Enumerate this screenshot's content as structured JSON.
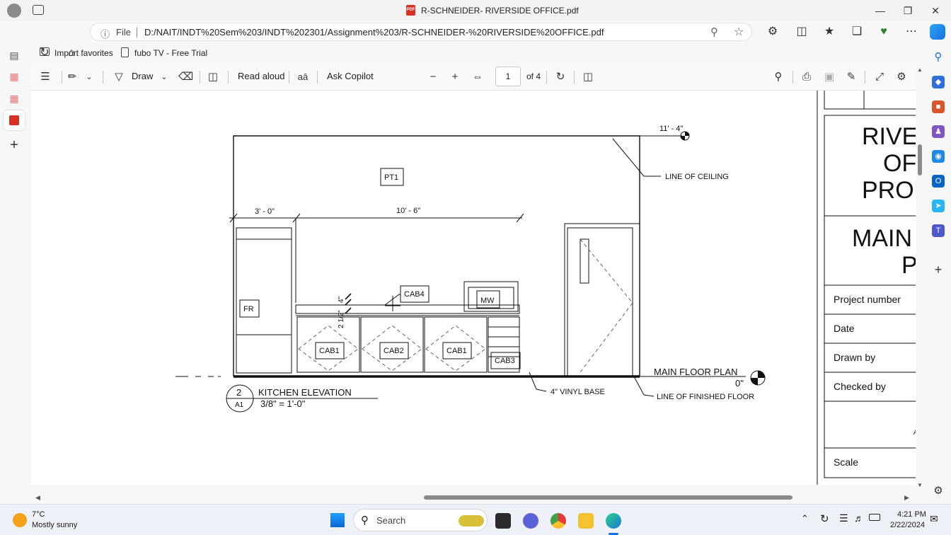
{
  "window": {
    "title": "R-SCHNEIDER- RIVERSIDE OFFICE.pdf",
    "pdf_badge": "PDF"
  },
  "address_bar": {
    "scheme_label": "File",
    "url": "D:/NAIT/INDT%20Sem%203/INDT%202301/Assignment%203/R-SCHNEIDER-%20RIVERSIDE%20OFFICE.pdf"
  },
  "favorites": {
    "items": [
      "Import favorites",
      "fubo TV - Free Trial"
    ]
  },
  "pdf_toolbar": {
    "draw_label": "Draw",
    "read_aloud_label": "Read aloud",
    "ask_copilot_label": "Ask Copilot",
    "current_page": "1",
    "page_total": "of 4"
  },
  "drawing": {
    "dim_overall_height": "11' - 4\"",
    "line_of_ceiling": "LINE OF CEILING",
    "dim_fridge_width": "3' - 0\"",
    "dim_counter_width": "10' - 6\"",
    "tag_pt1": "PT1",
    "tag_fr": "FR",
    "tag_cab4": "CAB4",
    "tag_mw": "MW",
    "dim_backsplash": "2 1/2\"",
    "dim_backsplash2": "4\"",
    "tag_cab1_a": "CAB1",
    "tag_cab2": "CAB2",
    "tag_cab1_b": "CAB1",
    "tag_cab3": "CAB3",
    "main_floor_plan": "MAIN FLOOR PLAN",
    "main_floor_elev": "0\"",
    "vinyl_base": "4\" VINYL BASE",
    "line_of_finished_floor": "LINE OF FINISHED FLOOR",
    "detail_number": "2",
    "detail_sheet": "A1",
    "detail_title": "KITCHEN ELEVATION",
    "detail_scale": "3/8\" = 1'-0\""
  },
  "title_block": {
    "project_name_1": "RIVE",
    "project_name_2": "OF",
    "project_name_3": "PRO",
    "sheet_name_1": "MAIN",
    "sheet_name_2": "P",
    "rows": [
      "Project number",
      "Date",
      "Drawn by",
      "Checked by"
    ],
    "scale_label": "Scale",
    "cut_char": "A"
  },
  "taskbar": {
    "temperature": "7°C",
    "weather": "Mostly sunny",
    "search_placeholder": "Search",
    "time": "4:21 PM",
    "date": "2/22/2024"
  }
}
